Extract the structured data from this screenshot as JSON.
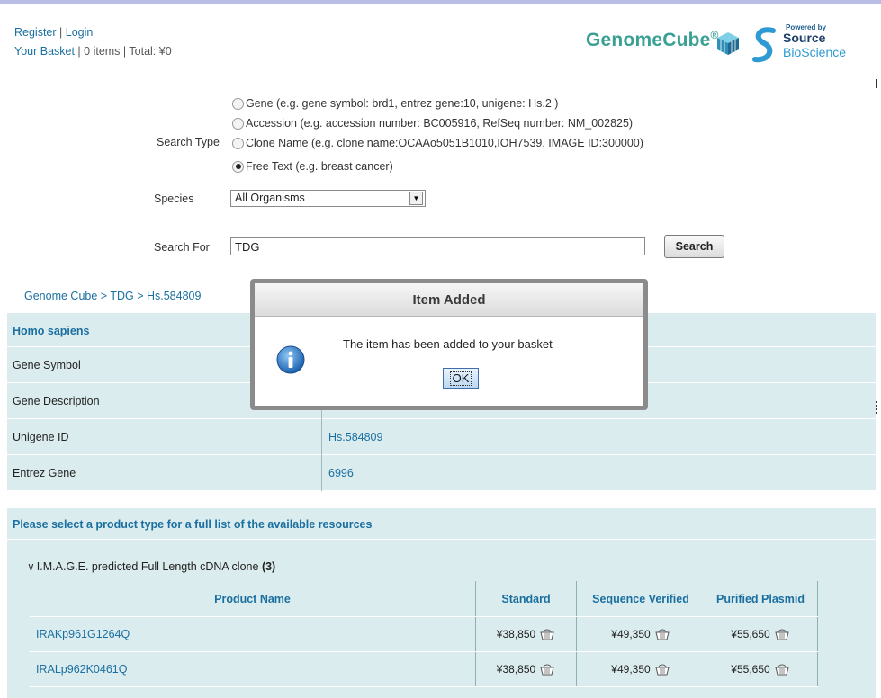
{
  "header": {
    "register": "Register",
    "sep1": " | ",
    "login": "Login",
    "basket_link": "Your Basket",
    "basket_info": " | 0 items | Total: ¥0",
    "logo_name": "GenomeCube",
    "logo_reg": "®",
    "powered_by": "Powered by",
    "logo_source": "Source",
    "logo_bio": "BioScience"
  },
  "search": {
    "search_type_label": "Search Type",
    "options": [
      {
        "label": "Gene (e.g. gene symbol: brd1, entrez gene:10, unigene: Hs.2 )",
        "checked": false
      },
      {
        "label": "Accession (e.g. accession number: BC005916, RefSeq number: NM_002825)",
        "checked": false
      },
      {
        "label": "Clone Name (e.g. clone name:OCAAo5051B1010,IOH7539, IMAGE ID:300000)",
        "checked": false
      },
      {
        "label": "Free Text (e.g. breast cancer)",
        "checked": true
      }
    ],
    "species_label": "Species",
    "species_value": "All Organisms",
    "search_for_label": "Search For",
    "query": "TDG",
    "button": "Search"
  },
  "breadcrumb": {
    "items": [
      "Genome Cube",
      " > ",
      "TDG",
      " > ",
      "Hs.584809"
    ]
  },
  "gene_info": {
    "organism": "Homo sapiens",
    "rows": [
      {
        "key": "Gene Symbol",
        "value": ""
      },
      {
        "key": "Gene Description",
        "value": ""
      },
      {
        "key": "Unigene ID",
        "value": "Hs.584809"
      },
      {
        "key": "Entrez Gene",
        "value": "6996"
      }
    ]
  },
  "products": {
    "heading": "Please select a product type for a full list of the available resources",
    "group_title": "I.M.A.G.E. predicted Full Length cDNA clone",
    "group_count": "(3)",
    "columns": [
      "Product Name",
      "Standard",
      "Sequence Verified",
      "Purified Plasmid"
    ],
    "rows": [
      {
        "name": "IRAKp961G1264Q",
        "standard": "¥38,850",
        "verified": "¥49,350",
        "plasmid": "¥55,650"
      },
      {
        "name": "IRALp962K0461Q",
        "standard": "¥38,850",
        "verified": "¥49,350",
        "plasmid": "¥55,650"
      }
    ]
  },
  "modal": {
    "title": "Item Added",
    "message": "The item has been added to your basket",
    "ok": "OK"
  },
  "colors": {
    "link": "#1a6fa0",
    "panel": "#dbecee",
    "brand": "#3aa094"
  },
  "icons": [
    "info-icon",
    "basket-icon",
    "chevron-down-icon",
    "cube-icon"
  ]
}
